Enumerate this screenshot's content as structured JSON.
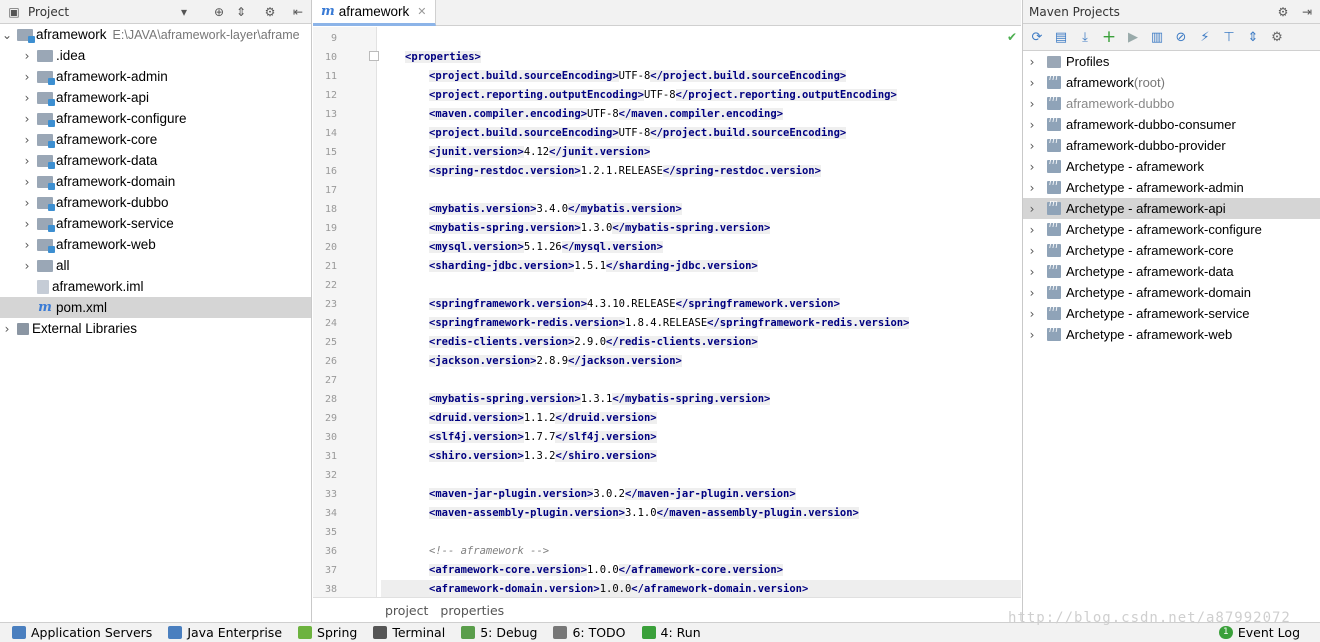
{
  "project_panel": {
    "title": "Project",
    "root": {
      "name": "aframework",
      "path": "E:\\JAVA\\aframework-layer\\aframe"
    },
    "items": [
      {
        "label": "aframework",
        "kind": "root"
      },
      {
        "label": ".idea",
        "kind": "folder"
      },
      {
        "label": "aframework-admin",
        "kind": "module"
      },
      {
        "label": "aframework-api",
        "kind": "module"
      },
      {
        "label": "aframework-configure",
        "kind": "module"
      },
      {
        "label": "aframework-core",
        "kind": "module"
      },
      {
        "label": "aframework-data",
        "kind": "module"
      },
      {
        "label": "aframework-domain",
        "kind": "module"
      },
      {
        "label": "aframework-dubbo",
        "kind": "module"
      },
      {
        "label": "aframework-service",
        "kind": "module"
      },
      {
        "label": "aframework-web",
        "kind": "module"
      },
      {
        "label": "all",
        "kind": "folder"
      },
      {
        "label": "aframework.iml",
        "kind": "file"
      },
      {
        "label": "pom.xml",
        "kind": "maven-file",
        "selected": true
      },
      {
        "label": "External Libraries",
        "kind": "library"
      }
    ]
  },
  "editor": {
    "tab": "aframework",
    "tab_icon": "m",
    "lines": [
      {
        "n": "9",
        "text": ""
      },
      {
        "n": "10",
        "text": "<properties>"
      },
      {
        "n": "11",
        "text": "<project.build.sourceEncoding>UTF-8</project.build.sourceEncoding>"
      },
      {
        "n": "12",
        "text": "<project.reporting.outputEncoding>UTF-8</project.reporting.outputEncoding>"
      },
      {
        "n": "13",
        "text": "<maven.compiler.encoding>UTF-8</maven.compiler.encoding>"
      },
      {
        "n": "14",
        "text": "<project.build.sourceEncoding>UTF-8</project.build.sourceEncoding>"
      },
      {
        "n": "15",
        "text": "<junit.version>4.12</junit.version>"
      },
      {
        "n": "16",
        "text": "<spring-restdoc.version>1.2.1.RELEASE</spring-restdoc.version>"
      },
      {
        "n": "17",
        "text": ""
      },
      {
        "n": "18",
        "text": "<mybatis.version>3.4.0</mybatis.version>"
      },
      {
        "n": "19",
        "text": "<mybatis-spring.version>1.3.0</mybatis-spring.version>"
      },
      {
        "n": "20",
        "text": "<mysql.version>5.1.26</mysql.version>"
      },
      {
        "n": "21",
        "text": "<sharding-jdbc.version>1.5.1</sharding-jdbc.version>"
      },
      {
        "n": "22",
        "text": ""
      },
      {
        "n": "23",
        "text": "<springframework.version>4.3.10.RELEASE</springframework.version>"
      },
      {
        "n": "24",
        "text": "<springframework-redis.version>1.8.4.RELEASE</springframework-redis.version>"
      },
      {
        "n": "25",
        "text": "<redis-clients.version>2.9.0</redis-clients.version>"
      },
      {
        "n": "26",
        "text": "<jackson.version>2.8.9</jackson.version>"
      },
      {
        "n": "27",
        "text": ""
      },
      {
        "n": "28",
        "text": "<mybatis-spring.version>1.3.1</mybatis-spring.version>"
      },
      {
        "n": "29",
        "text": "<druid.version>1.1.2</druid.version>"
      },
      {
        "n": "30",
        "text": "<slf4j.version>1.7.7</slf4j.version>"
      },
      {
        "n": "31",
        "text": "<shiro.version>1.3.2</shiro.version>"
      },
      {
        "n": "32",
        "text": ""
      },
      {
        "n": "33",
        "text": "<maven-jar-plugin.version>3.0.2</maven-jar-plugin.version>"
      },
      {
        "n": "34",
        "text": "<maven-assembly-plugin.version>3.1.0</maven-assembly-plugin.version>"
      },
      {
        "n": "35",
        "text": ""
      },
      {
        "n": "36",
        "text": "<!-- aframework -->"
      },
      {
        "n": "37",
        "text": "<aframework-core.version>1.0.0</aframework-core.version>"
      },
      {
        "n": "38",
        "text": "<aframework-domain.version>1.0.0</aframework-domain.version>"
      }
    ],
    "breadcrumb": [
      "project",
      "properties"
    ]
  },
  "maven_panel": {
    "title": "Maven Projects",
    "items": [
      {
        "label": "Profiles",
        "suffix": "",
        "kind": "profiles"
      },
      {
        "label": "aframework",
        "suffix": " (root)",
        "kind": "project"
      },
      {
        "label": "aframework-dubbo",
        "suffix": "",
        "kind": "project",
        "dim": true
      },
      {
        "label": "aframework-dubbo-consumer",
        "suffix": "",
        "kind": "project"
      },
      {
        "label": "aframework-dubbo-provider",
        "suffix": "",
        "kind": "project"
      },
      {
        "label": "Archetype - aframework",
        "suffix": "",
        "kind": "project"
      },
      {
        "label": "Archetype - aframework-admin",
        "suffix": "",
        "kind": "project"
      },
      {
        "label": "Archetype - aframework-api",
        "suffix": "",
        "kind": "project",
        "selected": true
      },
      {
        "label": "Archetype - aframework-configure",
        "suffix": "",
        "kind": "project"
      },
      {
        "label": "Archetype - aframework-core",
        "suffix": "",
        "kind": "project"
      },
      {
        "label": "Archetype - aframework-data",
        "suffix": "",
        "kind": "project"
      },
      {
        "label": "Archetype - aframework-domain",
        "suffix": "",
        "kind": "project"
      },
      {
        "label": "Archetype - aframework-service",
        "suffix": "",
        "kind": "project"
      },
      {
        "label": "Archetype - aframework-web",
        "suffix": "",
        "kind": "project"
      }
    ]
  },
  "statusbar": {
    "items": [
      {
        "label": "Application Servers",
        "icon": "server-icon",
        "color": "#4a7fbf"
      },
      {
        "label": "Java Enterprise",
        "icon": "java-ee-icon",
        "color": "#4a7fbf"
      },
      {
        "label": "Spring",
        "icon": "spring-icon",
        "color": "#6db33f"
      },
      {
        "label": "Terminal",
        "icon": "terminal-icon",
        "color": "#555555"
      },
      {
        "label": "5: Debug",
        "icon": "debug-icon",
        "color": "#5a9e4b"
      },
      {
        "label": "6: TODO",
        "icon": "todo-icon",
        "color": "#777777"
      },
      {
        "label": "4: Run",
        "icon": "run-icon",
        "color": "#3aa03a"
      }
    ],
    "event_log": "Event Log",
    "event_count": "1"
  },
  "watermark": "http://blog.csdn.net/a87992072"
}
